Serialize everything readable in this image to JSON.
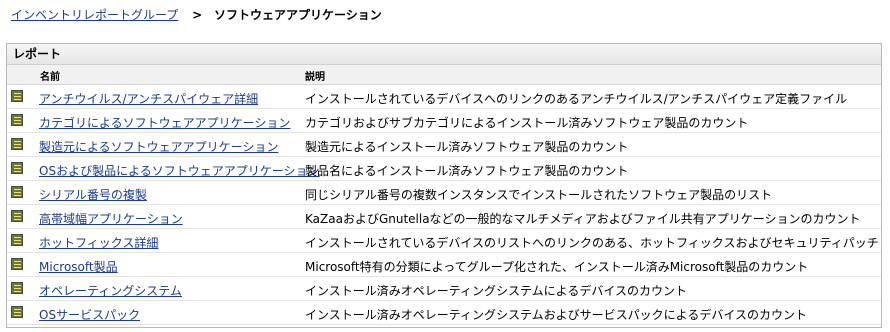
{
  "breadcrumb": {
    "parent": "インベントリレポートグループ",
    "separator": ">",
    "current": "ソフトウェアアプリケーション"
  },
  "panel": {
    "title": "レポート",
    "columns": {
      "name": "名前",
      "description": "説明"
    },
    "rows": [
      {
        "name": "アンチウイルス/アンチスパイウェア詳細",
        "description": "インストールされているデバイスへのリンクのあるアンチウイルス/アンチスパイウェア定義ファイル",
        "icon": "report-icon"
      },
      {
        "name": "カテゴリによるソフトウェアアプリケーション",
        "description": "カテゴリおよびサブカテゴリによるインストール済みソフトウェア製品のカウント",
        "icon": "report-icon"
      },
      {
        "name": "製造元によるソフトウェアアプリケーション",
        "description": "製造元によるインストール済みソフトウェア製品のカウント",
        "icon": "report-icon"
      },
      {
        "name": "OSおよび製品によるソフトウェアアプリケーション",
        "description": "製品名によるインストール済みソフトウェア製品のカウント",
        "icon": "report-icon"
      },
      {
        "name": "シリアル番号の複製",
        "description": "同じシリアル番号の複数インスタンスでインストールされたソフトウェア製品のリスト",
        "icon": "report-icon"
      },
      {
        "name": "高帯域幅アプリケーション",
        "description": "KaZaaおよびGnutellaなどの一般的なマルチメディアおよびファイル共有アプリケーションのカウント",
        "icon": "report-icon"
      },
      {
        "name": "ホットフィックス詳細",
        "description": "インストールされているデバイスのリストへのリンクのある、ホットフィックスおよびセキュリティパッチ",
        "icon": "report-icon"
      },
      {
        "name": "Microsoft製品",
        "description": "Microsoft特有の分類によってグループ化された、インストール済みMicrosoft製品のカウント",
        "icon": "report-icon"
      },
      {
        "name": "オペレーティングシステム",
        "description": "インストール済みオペレーティングシステムによるデバイスのカウント",
        "icon": "report-icon"
      },
      {
        "name": "OSサービスパック",
        "description": "インストール済みオペレーティングシステムおよびサービスパックによるデバイスのカウント",
        "icon": "report-icon"
      }
    ]
  }
}
